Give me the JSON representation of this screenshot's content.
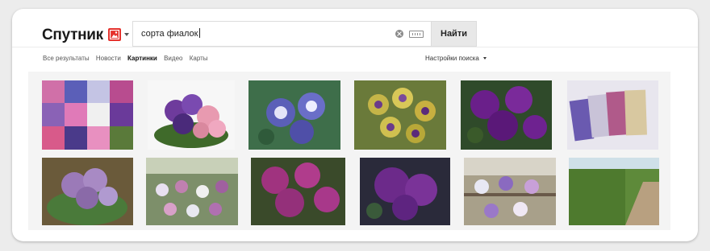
{
  "header": {
    "logo_text": "Спутник",
    "search_query": "сорта фиалок",
    "search_button_label": "Найти",
    "image_mode_icon": "picture-icon"
  },
  "tabs": [
    {
      "label": "Все результаты",
      "active": false
    },
    {
      "label": "Новости",
      "active": false
    },
    {
      "label": "Картинки",
      "active": true
    },
    {
      "label": "Видео",
      "active": false
    },
    {
      "label": "Карты",
      "active": false
    }
  ],
  "settings_label": "Настройки поиска",
  "images": [
    {
      "subject": "collage of violet varieties",
      "tone": "#b84c8f"
    },
    {
      "subject": "purple and pink violets",
      "tone": "#6e3b9c"
    },
    {
      "subject": "blue violets with white edges",
      "tone": "#5b5fb8"
    },
    {
      "subject": "yellow-purple striped violets",
      "tone": "#c5b548"
    },
    {
      "subject": "deep purple violets",
      "tone": "#6a1f8a"
    },
    {
      "subject": "seed packets",
      "tone": "#c9c3d8"
    },
    {
      "subject": "lilac violet in pot",
      "tone": "#9b7ab8"
    },
    {
      "subject": "greenhouse with violets",
      "tone": "#7d8f6a"
    },
    {
      "subject": "magenta violets",
      "tone": "#a0337f"
    },
    {
      "subject": "purple violet close-up",
      "tone": "#6c2a8a"
    },
    {
      "subject": "shelf of potted violets",
      "tone": "#a8a08a"
    },
    {
      "subject": "garden hedge",
      "tone": "#5e8a3a"
    }
  ]
}
